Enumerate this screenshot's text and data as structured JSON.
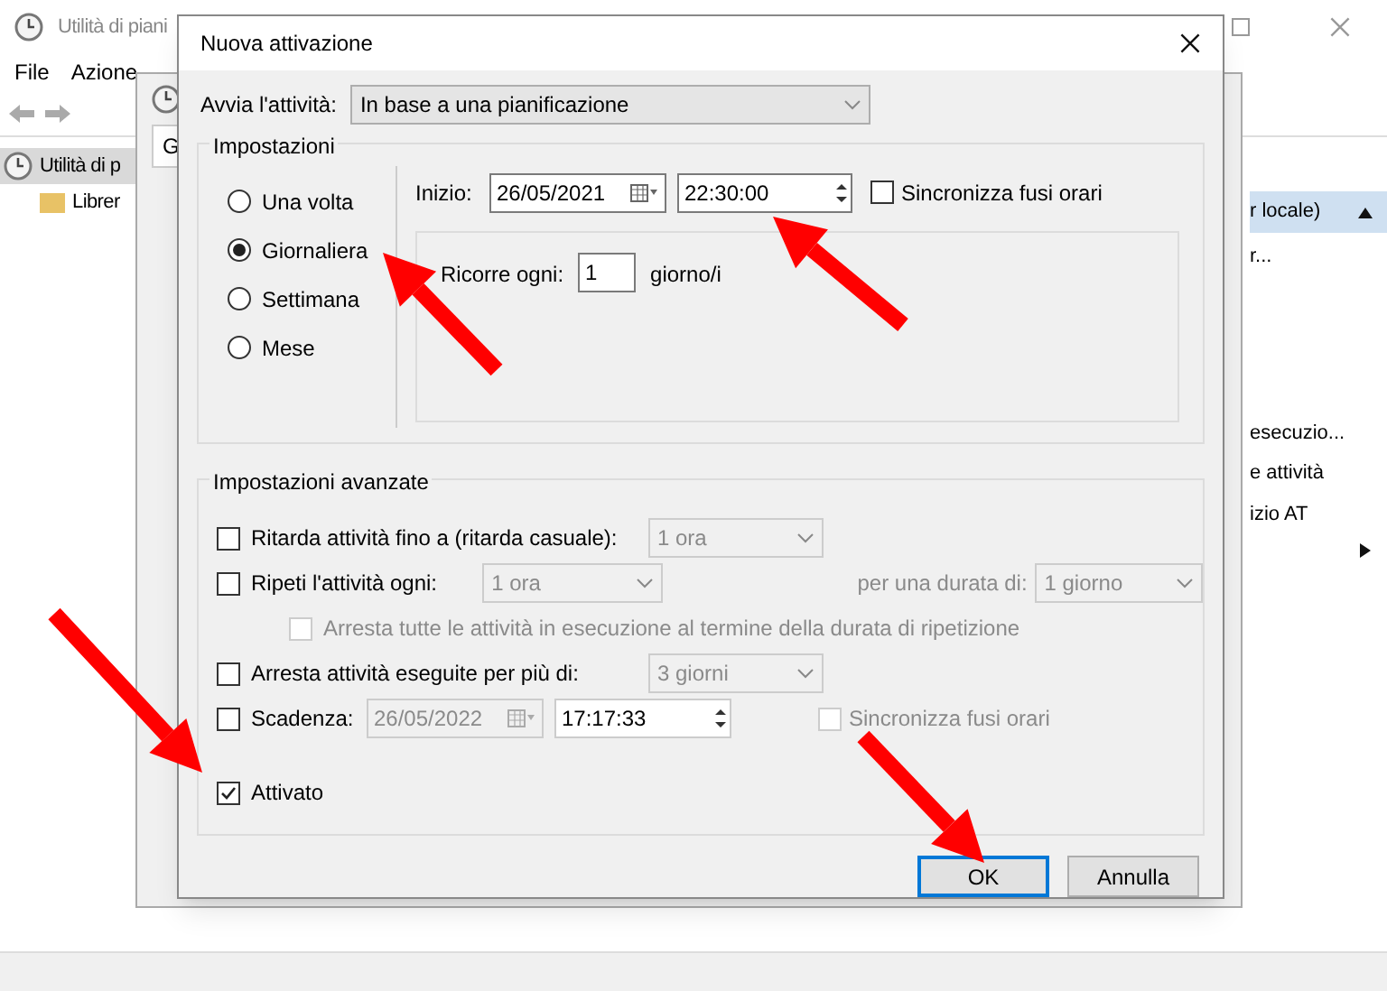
{
  "background_window": {
    "title": "Utilità di piani",
    "menu": [
      "File",
      "Azione"
    ],
    "tree": [
      {
        "label": "Utilità di p",
        "selected": true,
        "children": [
          {
            "label": "Librer",
            "selected": false
          }
        ]
      }
    ],
    "actions_header": "r locale)",
    "actions": [
      "r...",
      "esecuzio...",
      "e attività",
      "izio AT"
    ]
  },
  "middle_window": {
    "tab": "G"
  },
  "dialog": {
    "title": "Nuova attivazione",
    "start_label": "Avvia l'attività:",
    "start_value": "In base a una pianificazione",
    "settings": {
      "legend": "Impostazioni",
      "frequency": [
        {
          "label": "Una volta",
          "selected": false
        },
        {
          "label": "Giornaliera",
          "selected": true
        },
        {
          "label": "Settimana",
          "selected": false
        },
        {
          "label": "Mese",
          "selected": false
        }
      ],
      "start_label": "Inizio:",
      "date": "26/05/2021",
      "time": "22:30:00",
      "sync_label": "Sincronizza fusi orari",
      "sync_checked": false,
      "recur_label": "Ricorre ogni:",
      "recur_value": "1",
      "recur_unit": "giorno/i"
    },
    "advanced": {
      "legend": "Impostazioni avanzate",
      "delay": {
        "label": "Ritarda attività fino a (ritarda casuale):",
        "checked": false,
        "value": "1 ora"
      },
      "repeat": {
        "label": "Ripeti l'attività ogni:",
        "checked": false,
        "value": "1 ora",
        "duration_label": "per una durata di:",
        "duration_value": "1 giorno"
      },
      "stop_all": {
        "label": "Arresta tutte le attività in esecuzione al termine della durata di ripetizione",
        "checked": false,
        "disabled": true
      },
      "stop_longer": {
        "label": "Arresta attività eseguite per più di:",
        "checked": false,
        "value": "3 giorni"
      },
      "expire": {
        "label": "Scadenza:",
        "checked": false,
        "date": "26/05/2022",
        "time": "17:17:33",
        "sync_label": "Sincronizza fusi orari",
        "sync_checked": false
      },
      "enabled": {
        "label": "Attivato",
        "checked": true
      }
    },
    "buttons": [
      {
        "label": "OK",
        "default": true
      },
      {
        "label": "Annulla",
        "default": false
      }
    ]
  }
}
